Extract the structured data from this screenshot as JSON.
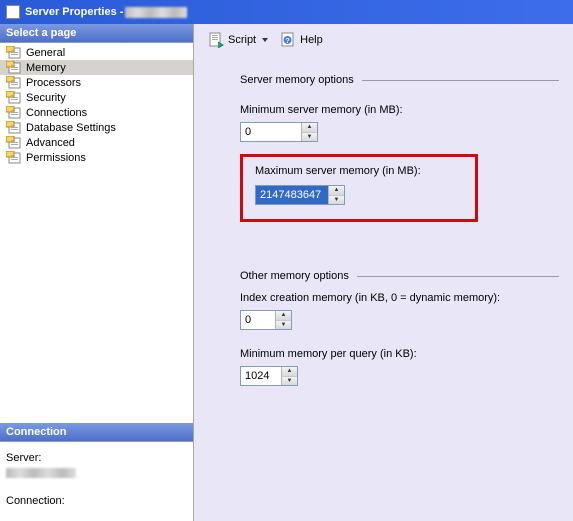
{
  "window": {
    "title_prefix": "Server Properties - "
  },
  "sidebar": {
    "select_page": "Select a page",
    "items": [
      {
        "label": "General"
      },
      {
        "label": "Memory",
        "selected": true
      },
      {
        "label": "Processors"
      },
      {
        "label": "Security"
      },
      {
        "label": "Connections"
      },
      {
        "label": "Database Settings"
      },
      {
        "label": "Advanced"
      },
      {
        "label": "Permissions"
      }
    ],
    "connection_header": "Connection",
    "server_label": "Server:",
    "connection_label": "Connection:"
  },
  "toolbar": {
    "script": "Script",
    "help": "Help"
  },
  "memory": {
    "server_memory_options": "Server memory options",
    "min_label": "Minimum server memory (in MB):",
    "min_value": "0",
    "max_label": "Maximum server memory (in MB):",
    "max_value": "2147483647",
    "other_options": "Other memory options",
    "index_label": "Index creation memory (in KB, 0 = dynamic memory):",
    "index_value": "0",
    "minquery_label": "Minimum memory per query (in KB):",
    "minquery_value": "1024"
  }
}
